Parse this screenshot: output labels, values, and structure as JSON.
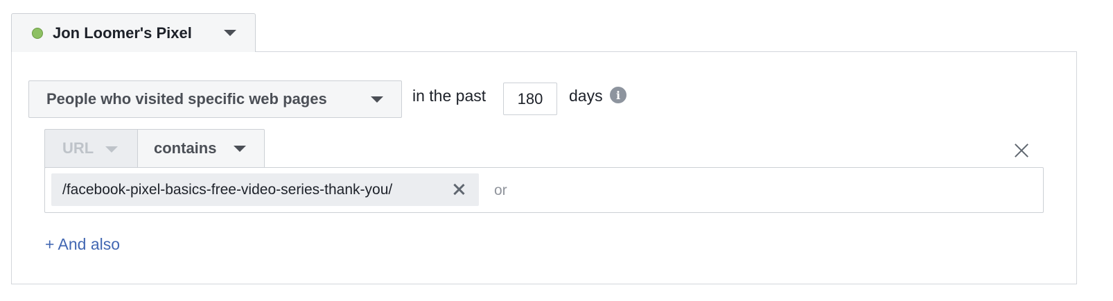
{
  "pixel": {
    "name": "Jon Loomer's Pixel",
    "status_color": "#8dc063",
    "status_icon": "status-dot-icon",
    "dropdown_icon": "caret-down-icon"
  },
  "rule": {
    "audience_type": "People who visited specific web pages",
    "past_label": "in the past",
    "days_value": "180",
    "days_label": "days",
    "info_icon": "info-icon",
    "info_glyph": "i"
  },
  "condition": {
    "field": "URL",
    "field_disabled": true,
    "operator": "contains",
    "remove_icon": "close-icon"
  },
  "tokens": {
    "values": [
      "/facebook-pixel-basics-free-video-series-thank-you/"
    ],
    "remove_icon": "close-icon",
    "placeholder": "or"
  },
  "actions": {
    "and_also": "+ And also"
  },
  "colors": {
    "link": "#4267b2",
    "status_active": "#8dc063"
  }
}
